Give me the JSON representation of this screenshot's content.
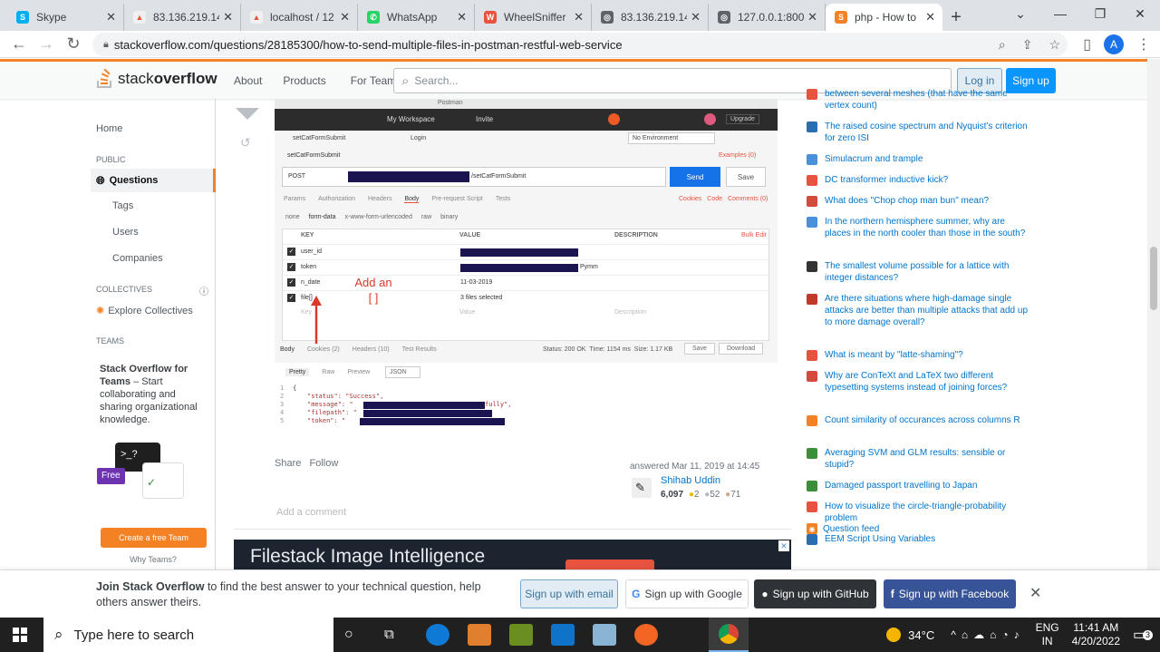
{
  "browser": {
    "tabs": [
      {
        "label": "Skype",
        "icon_color": "#00aff0",
        "glyph": "S"
      },
      {
        "label": "83.136.219.14",
        "icon_color": "#f0f0f0",
        "glyph": "▲"
      },
      {
        "label": "localhost / 12",
        "icon_color": "#f0f0f0",
        "glyph": "▲"
      },
      {
        "label": "WhatsApp",
        "icon_color": "#25d366",
        "glyph": "✆"
      },
      {
        "label": "WheelSniffer",
        "icon_color": "#e8533f",
        "glyph": "W"
      },
      {
        "label": "83.136.219.14",
        "icon_color": "#5f6368",
        "glyph": "◎"
      },
      {
        "label": "127.0.0.1:800",
        "icon_color": "#5f6368",
        "glyph": "◎"
      },
      {
        "label": "php - How to",
        "icon_color": "#f48225",
        "glyph": "S"
      }
    ],
    "url": "stackoverflow.com/questions/28185300/how-to-send-multiple-files-in-postman-restful-web-service",
    "profile_letter": "A"
  },
  "header": {
    "logo_part1": "stack",
    "logo_part2": "overflow",
    "links": [
      "About",
      "Products",
      "For Teams"
    ],
    "search_placeholder": "Search...",
    "login": "Log in",
    "signup": "Sign up"
  },
  "sidebar": {
    "home": "Home",
    "public": "PUBLIC",
    "questions": "Questions",
    "tags": "Tags",
    "users": "Users",
    "companies": "Companies",
    "collectives": "COLLECTIVES",
    "explore": "Explore Collectives",
    "teams_heading": "TEAMS",
    "teams_title": "Stack Overflow for Teams",
    "teams_text": " – Start collaborating and sharing organizational knowledge.",
    "free": "Free",
    "cta": "Create a free Team",
    "why": "Why Teams?"
  },
  "postman": {
    "title": "Postman",
    "workspace": "My Workspace",
    "invite": "Invite",
    "upgrade": "Upgrade",
    "tab1": "setCatFormSubmit",
    "tab2": "Login",
    "env": "No Environment",
    "request_name": "setCatFormSubmit",
    "examples": "Examples (0)",
    "method": "POST",
    "url_suffix": "/setCatFormSubmit",
    "send": "Send",
    "save": "Save",
    "subtabs": [
      "Params",
      "Authorization",
      "Headers",
      "Body",
      "Pre-request Script",
      "Tests"
    ],
    "right_links": [
      "Cookies",
      "Code",
      "Comments (0)"
    ],
    "body_types": [
      "none",
      "form-data",
      "x-www-form-urlencoded",
      "raw",
      "binary"
    ],
    "col_key": "KEY",
    "col_value": "VALUE",
    "col_desc": "DESCRIPTION",
    "bulk_edit": "Bulk Edit",
    "rows": [
      {
        "key": "user_id",
        "value": ""
      },
      {
        "key": "token",
        "value": "Pymm"
      },
      {
        "key": "n_date",
        "value": "11-03-2019"
      },
      {
        "key": "file[]",
        "value": "3 files selected"
      }
    ],
    "key_placeholder": "Key",
    "value_placeholder": "Value",
    "desc_placeholder": "Description",
    "annotation": "Add an [ ]",
    "resp_tabs": [
      "Body",
      "Cookies (2)",
      "Headers (10)",
      "Test Results"
    ],
    "status": "Status: 200 OK",
    "time": "Time: 1154 ms",
    "size": "Size: 1.17 KB",
    "resp_save": "Save",
    "download": "Download",
    "view_modes": [
      "Pretty",
      "Raw",
      "Preview"
    ],
    "format": "JSON",
    "code_lines": [
      "{",
      "\"status\": \"Success\",",
      "\"message\": \"",
      "\"filepath\": \"",
      "\"token\": \""
    ],
    "code_tail": "fully\","
  },
  "answer": {
    "share": "Share",
    "follow": "Follow",
    "answered": "answered Mar 11, 2019 at 14:45",
    "user": "Shihab Uddin",
    "reputation": "6,097",
    "gold": "2",
    "silver": "52",
    "bronze": "71",
    "add_comment": "Add a comment",
    "ad_text": "Filestack Image Intelligence"
  },
  "hot": [
    {
      "text": "between several meshes (that have the same vertex count)",
      "icon": "#e8533f"
    },
    {
      "text": "The raised cosine spectrum and Nyquist's criterion for zero ISI",
      "icon": "#2a6db0"
    },
    {
      "text": "Simulacrum and trample",
      "icon": "#4a90d9"
    },
    {
      "text": "DC transformer inductive kick?",
      "icon": "#e8533f"
    },
    {
      "text": "What does \"Chop chop man bun\" mean?",
      "icon": "#d24b3c"
    },
    {
      "text": "In the northern hemisphere summer, why are places in the north cooler than those in the south?",
      "icon": "#4a90d9"
    },
    {
      "text": "The smallest volume possible for a lattice with integer distances?",
      "icon": "#333333"
    },
    {
      "text": "Are there situations where high-damage single attacks are better than multiple attacks that add up to more damage overall?",
      "icon": "#c0392b"
    },
    {
      "text": "What is meant by \"latte-shaming\"?",
      "icon": "#e8533f"
    },
    {
      "text": "Why are ConTeXt and LaTeX two different typesetting systems instead of joining forces?",
      "icon": "#d24b3c"
    },
    {
      "text": "Count similarity of occurances across columns R",
      "icon": "#f48225"
    },
    {
      "text": "Averaging SVM and GLM results: sensible or stupid?",
      "icon": "#3b8f3b"
    },
    {
      "text": "Damaged passport travelling to Japan",
      "icon": "#3b8f3b"
    },
    {
      "text": "How to visualize the circle-triangle-probability problem",
      "icon": "#e8533f"
    },
    {
      "text": "EEM Script Using Variables",
      "icon": "#2a6db0"
    }
  ],
  "question_feed": "Question feed",
  "banner": {
    "join": "Join Stack Overflow",
    "rest": " to find the best answer to your technical question, help others answer theirs.",
    "email": "Sign up with email",
    "google": "Sign up with Google",
    "github": "Sign up with GitHub",
    "facebook": "Sign up with Facebook"
  },
  "taskbar": {
    "search": "Type here to search",
    "temp": "34°C",
    "lang1": "ENG",
    "lang2": "IN",
    "time": "11:41 AM",
    "date": "4/20/2022",
    "notif": "3"
  }
}
